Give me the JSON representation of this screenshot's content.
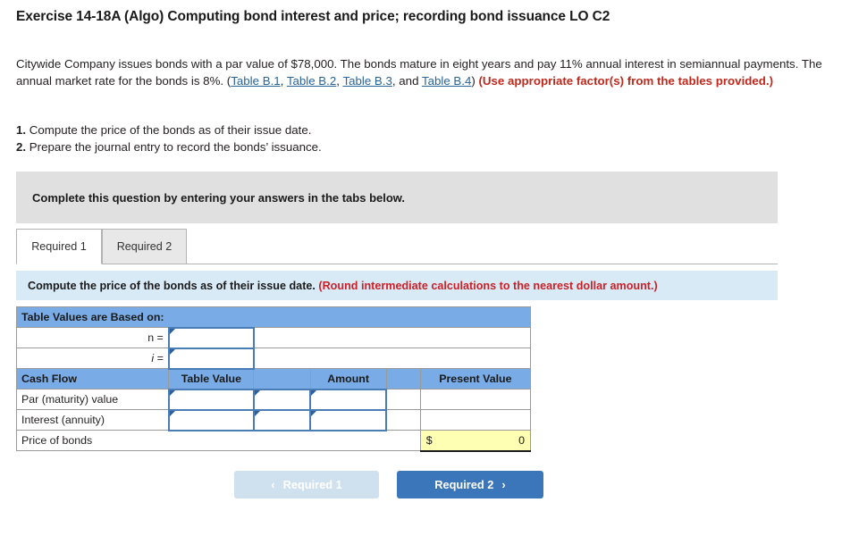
{
  "exercise": {
    "title": "Exercise 14-18A (Algo) Computing bond interest and price; recording bond issuance LO C2"
  },
  "problem": {
    "part1": "Citywide Company issues bonds with a par value of $78,000. The bonds mature in eight years and pay 11% annual interest in semiannual payments. The annual market rate for the bonds is 8%. (",
    "link1": "Table B.1",
    "sep1": ", ",
    "link2": "Table B.2",
    "sep2": ", ",
    "link3": "Table B.3",
    "sep3": ", and ",
    "link4": "Table B.4",
    "part2": ") ",
    "emphasis": "(Use appropriate factor(s) from the tables provided.)"
  },
  "requirements": {
    "item1_num": "1.",
    "item1_text": "Compute the price of the bonds as of their issue date.",
    "item2_num": "2.",
    "item2_text": "Prepare the journal entry to record the bonds’ issuance."
  },
  "gray_banner": {
    "text": "Complete this question by entering your answers in the tabs below."
  },
  "tabs": [
    {
      "label": "Required 1",
      "active": true
    },
    {
      "label": "Required 2",
      "active": false
    }
  ],
  "blue_bar": {
    "instruction": "Compute the price of the bonds as of their issue date.",
    "note": "(Round intermediate calculations to the nearest dollar amount.)"
  },
  "worksheet": {
    "based_on_header": "Table Values are Based on:",
    "n_label": "n =",
    "n_value": "",
    "i_label": "i =",
    "i_value": "",
    "columns": {
      "cash_flow": "Cash Flow",
      "table_value": "Table Value",
      "spacer1": "",
      "amount": "Amount",
      "spacer2": "",
      "present_value": "Present Value"
    },
    "rows": [
      {
        "label": "Par (maturity) value",
        "table_value": "",
        "mid": "",
        "amount": "",
        "present_value": ""
      },
      {
        "label": "Interest (annuity)",
        "table_value": "",
        "mid": "",
        "amount": "",
        "present_value": ""
      }
    ],
    "total_row": {
      "label": "Price of bonds",
      "currency": "$",
      "value": "0"
    }
  },
  "nav": {
    "prev_label": "Required 1",
    "prev_chevron": "‹",
    "next_label": "Required 2",
    "next_chevron": "›"
  },
  "colors": {
    "header_blue": "#79ace6",
    "instruction_blue": "#d9eaf7",
    "button_blue": "#3b75ba",
    "button_disabled": "#cfe0ef",
    "banner_gray": "#e0e0e0",
    "total_yellow": "#ffffb4",
    "red_emphasis": "#c0281c",
    "link_blue": "#2a6496"
  }
}
